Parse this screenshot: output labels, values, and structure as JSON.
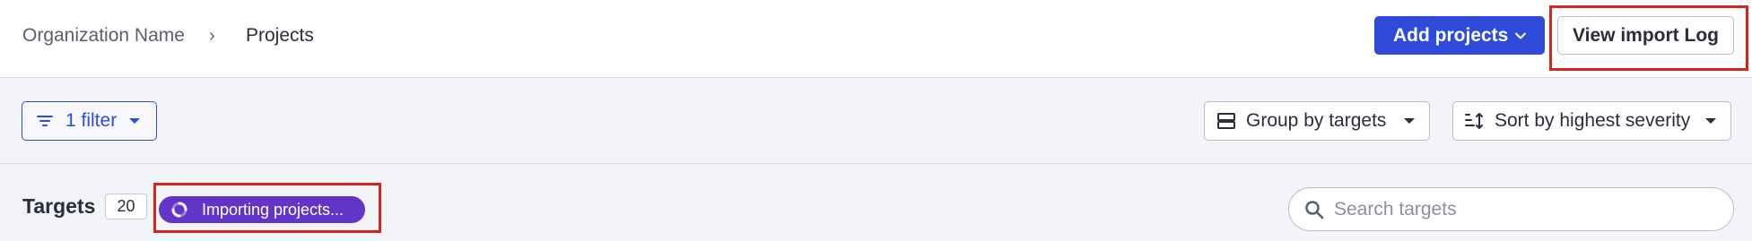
{
  "breadcrumb": {
    "org": "Organization Name",
    "separator": "›",
    "current": "Projects"
  },
  "header": {
    "add_projects_label": "Add projects",
    "view_import_log_label": "View import Log"
  },
  "toolbar": {
    "filter_label": "1 filter",
    "group_by_label": "Group by targets",
    "sort_label": "Sort by highest severity"
  },
  "targets": {
    "title": "Targets",
    "count": "20",
    "importing_label": "Importing projects...",
    "search_placeholder": "Search targets"
  },
  "colors": {
    "primary": "#2f4bd9",
    "importing": "#6235c8",
    "highlight": "#d4261f"
  },
  "icons": {
    "add_chevron": "chevron-down-icon",
    "filter": "filter-icon",
    "group": "group-rows-icon",
    "sort": "sort-severity-icon",
    "spinner": "spinner-icon",
    "search": "search-icon"
  }
}
